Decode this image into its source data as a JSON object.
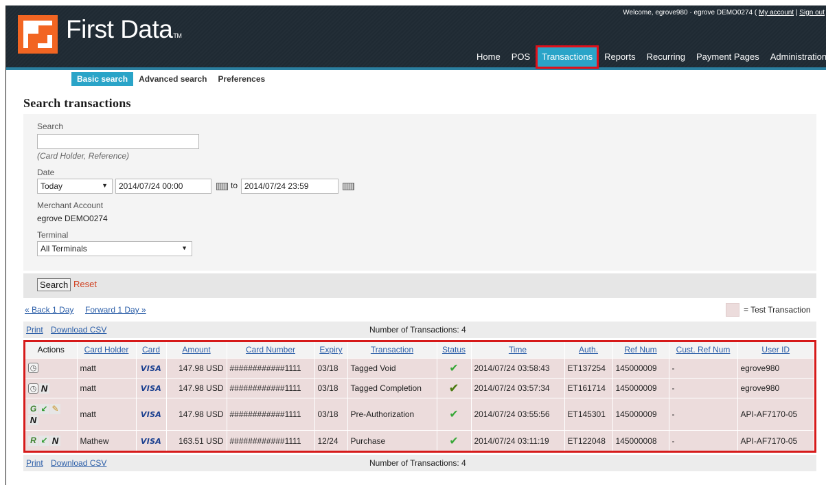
{
  "header": {
    "brand": "First Data",
    "brand_tm": "TM",
    "welcome_text": "Welcome, egrove980 ·  egrove DEMO0274 (",
    "my_account": "My account",
    "separator": "|",
    "sign_out": "Sign out",
    "nav": [
      {
        "label": "Home",
        "active": false
      },
      {
        "label": "POS",
        "active": false
      },
      {
        "label": "Transactions",
        "active": true
      },
      {
        "label": "Reports",
        "active": false
      },
      {
        "label": "Recurring",
        "active": false
      },
      {
        "label": "Payment Pages",
        "active": false
      },
      {
        "label": "Administration",
        "active": false
      }
    ],
    "colors": {
      "header_bg": "#1f2a33",
      "active_tab": "#2aa4c8",
      "highlight": "#e0101a"
    }
  },
  "subnav": [
    {
      "label": "Basic search",
      "active": true
    },
    {
      "label": "Advanced search",
      "active": false
    },
    {
      "label": "Preferences",
      "active": false
    }
  ],
  "page_title": "Search transactions",
  "form": {
    "search_label": "Search",
    "search_value": "",
    "search_hint": "(Card Holder, Reference)",
    "date_label": "Date",
    "date_range_selected": "Today",
    "date_from": "2014/07/24 00:00",
    "date_to_label": "to",
    "date_to": "2014/07/24 23:59",
    "merchant_label": "Merchant Account",
    "merchant_value": "egrove DEMO0274",
    "terminal_label": "Terminal",
    "terminal_selected": "All Terminals",
    "search_button": "Search",
    "reset_link": "Reset"
  },
  "paging": {
    "back": "« Back 1 Day",
    "forward": "Forward 1 Day »",
    "legend_label": "= Test Transaction"
  },
  "tools": {
    "print": "Print",
    "download_csv": "Download CSV",
    "count_text": "Number of Transactions: 4"
  },
  "table": {
    "columns": [
      "Actions",
      "Card Holder",
      "Card",
      "Amount",
      "Card Number",
      "Expiry",
      "Transaction",
      "Status",
      "Time",
      "Auth.",
      "Ref Num",
      "Cust. Ref Num",
      "User ID"
    ],
    "rows": [
      {
        "actions": [
          "clock"
        ],
        "card_holder": "matt",
        "card": "VISA",
        "amount": "147.98 USD",
        "card_number": "############1111",
        "expiry": "03/18",
        "transaction": "Tagged Void",
        "status": "check",
        "time": "2014/07/24 03:58:43",
        "auth": "ET137254",
        "ref_num": "145000009",
        "cust_ref": "-",
        "user_id": "egrove980"
      },
      {
        "actions": [
          "clock",
          "N"
        ],
        "card_holder": "matt",
        "card": "VISA",
        "amount": "147.98 USD",
        "card_number": "############1111",
        "expiry": "03/18",
        "transaction": "Tagged Completion",
        "status": "check",
        "time": "2014/07/24 03:57:34",
        "auth": "ET161714",
        "ref_num": "145000009",
        "cust_ref": "-",
        "user_id": "egrove980"
      },
      {
        "actions": [
          "G",
          "arrow",
          "pen",
          "N"
        ],
        "card_holder": "matt",
        "card": "VISA",
        "amount": "147.98 USD",
        "card_number": "############1111",
        "expiry": "03/18",
        "transaction": "Pre-Authorization",
        "status": "check",
        "time": "2014/07/24 03:55:56",
        "auth": "ET145301",
        "ref_num": "145000009",
        "cust_ref": "-",
        "user_id": "API-AF7170-05"
      },
      {
        "actions": [
          "R",
          "arrow",
          "N"
        ],
        "card_holder": "Mathew",
        "card": "VISA",
        "amount": "163.51 USD",
        "card_number": "############1111",
        "expiry": "12/24",
        "transaction": "Purchase",
        "status": "check",
        "time": "2014/07/24 03:11:19",
        "auth": "ET122048",
        "ref_num": "145000008",
        "cust_ref": "-",
        "user_id": "API-AF7170-05"
      }
    ]
  }
}
